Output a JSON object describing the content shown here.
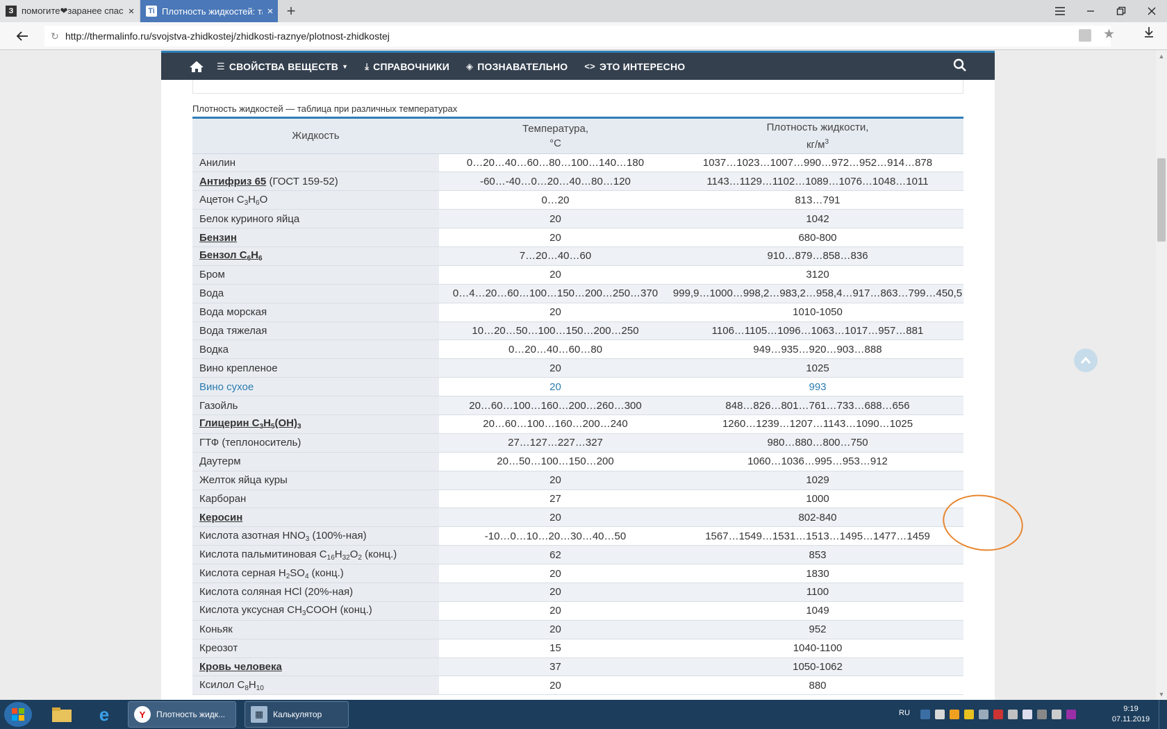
{
  "browser": {
    "tabs": [
      {
        "title": "помогите❤заранее спасибо",
        "favicon": "З",
        "active": false
      },
      {
        "title": "Плотность жидкостей: та",
        "favicon": "Ti",
        "active": true
      }
    ],
    "url": "http://thermalinfo.ru/svojstva-zhidkostej/zhidkosti-raznye/plotnost-zhidkostej"
  },
  "nav": {
    "items": [
      "СВОЙСТВА ВЕЩЕСТВ",
      "СПРАВОЧНИКИ",
      "ПОЗНАВАТЕЛЬНО",
      "ЭТО ИНТЕРЕСНО"
    ]
  },
  "caption": "Плотность жидкостей — таблица при различных температурах",
  "table": {
    "headers": {
      "liquid": "Жидкость",
      "temp_line1": "Температура,",
      "temp_line2": "°С",
      "dens_line1": "Плотность жидкости,",
      "dens_unit": "кг/м",
      "dens_sup": "3"
    },
    "rows": [
      {
        "name": "Анилин",
        "temp": "0…20…40…60…80…100…140…180",
        "density": "1037…1023…1007…990…972…952…914…878"
      },
      {
        "name": "Антифриз 65",
        "suffix": " (ГОСТ 159-52)",
        "temp": "-60…-40…0…20…40…80…120",
        "density": "1143…1129…1102…1089…1076…1048…1011"
      },
      {
        "name": "Ацетон C",
        "formula": [
          "3",
          "H",
          "6",
          "O"
        ],
        "temp": "0…20",
        "density": "813…791"
      },
      {
        "name": "Белок куриного яйца",
        "temp": "20",
        "density": "1042"
      },
      {
        "name": "Бензин",
        "temp": "20",
        "density": "680-800"
      },
      {
        "name": "Бензол C",
        "formula": [
          "6",
          "H",
          "6"
        ],
        "temp": "7…20…40…60",
        "density": "910…879…858…836"
      },
      {
        "name": "Бром",
        "temp": "20",
        "density": "3120"
      },
      {
        "name": "Вода",
        "temp": "0…4…20…60…100…150…200…250…370",
        "density": "999,9…1000…998,2…983,2…958,4…917…863…799…450,5"
      },
      {
        "name": "Вода морская",
        "temp": "20",
        "density": "1010-1050"
      },
      {
        "name": "Вода тяжелая",
        "temp": "10…20…50…100…150…200…250",
        "density": "1106…1105…1096…1063…1017…957…881"
      },
      {
        "name": "Водка",
        "temp": "0…20…40…60…80",
        "density": "949…935…920…903…888"
      },
      {
        "name": "Вино крепленое",
        "temp": "20",
        "density": "1025"
      },
      {
        "name": "Вино сухое",
        "temp": "20",
        "density": "993"
      },
      {
        "name": "Газойль",
        "temp": "20…60…100…160…200…260…300",
        "density": "848…826…801…761…733…688…656"
      },
      {
        "name": "Глицерин C",
        "formula": [
          "3",
          "H",
          "5",
          "(OH)",
          "3"
        ],
        "temp": "20…60…100…160…200…240",
        "density": "1260…1239…1207…1143…1090…1025"
      },
      {
        "name": "ГТФ (теплоноситель)",
        "temp": "27…127…227…327",
        "density": "980…880…800…750"
      },
      {
        "name": "Даутерм",
        "temp": "20…50…100…150…200",
        "density": "1060…1036…995…953…912"
      },
      {
        "name": "Желток яйца куры",
        "temp": "20",
        "density": "1029"
      },
      {
        "name": "Карборан",
        "temp": "27",
        "density": "1000"
      },
      {
        "name": "Керосин",
        "temp": "20",
        "density": "802-840"
      },
      {
        "name": "Кислота азотная HNO",
        "formula": [
          "3",
          " (100%-ная)"
        ],
        "temp": "-10…0…10…20…30…40…50",
        "density": "1567…1549…1531…1513…1495…1477…1459"
      },
      {
        "name": "Кислота пальмитиновая C",
        "formula": [
          "16",
          "H",
          "32",
          "O",
          "2",
          " (конц.)"
        ],
        "temp": "62",
        "density": "853"
      },
      {
        "name": "Кислота серная H",
        "formula": [
          "2",
          "SO",
          "4",
          " (конц.)"
        ],
        "temp": "20",
        "density": "1830"
      },
      {
        "name": "Кислота соляная HCl (20%-ная)",
        "temp": "20",
        "density": "1100"
      },
      {
        "name": "Кислота уксусная CH",
        "formula": [
          "3",
          "COOH (конц.)"
        ],
        "temp": "20",
        "density": "1049"
      },
      {
        "name": "Коньяк",
        "temp": "20",
        "density": "952"
      },
      {
        "name": "Креозот",
        "temp": "15",
        "density": "1040-1100"
      },
      {
        "name": "Кровь человека",
        "temp": "37",
        "density": "1050-1062"
      },
      {
        "name": "Ксилол C",
        "formula": [
          "8",
          "H",
          "10"
        ],
        "temp": "20",
        "density": "880"
      }
    ]
  },
  "taskbar": {
    "buttons": [
      "Плотность жидк...",
      "Калькулятор"
    ],
    "lang": "RU",
    "time": "9:19",
    "date": "07.11.2019"
  },
  "colors": {
    "nav_bg": "#34404e",
    "accent": "#2f7fb7",
    "annotation": "#e8862e",
    "highlight_text": "#2c7cb0"
  }
}
